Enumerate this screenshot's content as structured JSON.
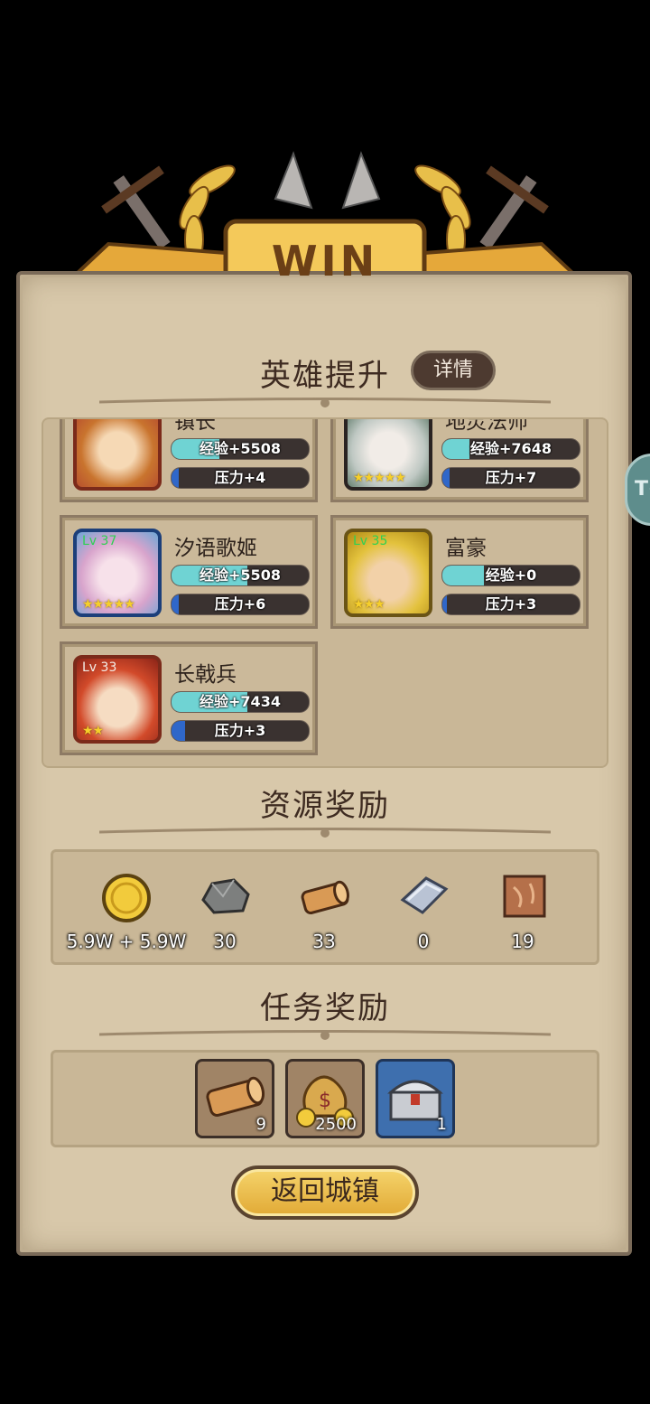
{
  "banner": {
    "title": "WIN"
  },
  "side_bubble_text": "T(",
  "hero_section": {
    "title": "英雄提升",
    "detail_button": "详情",
    "heroes": [
      {
        "name": "镇长",
        "level": "",
        "exp": "经验+5508",
        "exp_fill": 0.35,
        "pressure": "压力+4",
        "pressure_fill": 0.05,
        "stars": ""
      },
      {
        "name": "地灵法师",
        "level": "",
        "exp": "经验+7648",
        "exp_fill": 0.2,
        "pressure": "压力+7",
        "pressure_fill": 0.05,
        "stars": "★★★★★"
      },
      {
        "name": "汐语歌姬",
        "level": "Lv 37",
        "exp": "经验+5508",
        "exp_fill": 0.55,
        "pressure": "压力+6",
        "pressure_fill": 0.05,
        "stars": "★★★★★"
      },
      {
        "name": "富豪",
        "level": "Lv 35",
        "exp": "经验+0",
        "exp_fill": 0.3,
        "pressure": "压力+3",
        "pressure_fill": 0.03,
        "stars": "★★★"
      },
      {
        "name": "长戟兵",
        "level": "Lv 33",
        "exp": "经验+7434",
        "exp_fill": 0.55,
        "pressure": "压力+3",
        "pressure_fill": 0.1,
        "stars": "★★"
      }
    ]
  },
  "resource_section": {
    "title": "资源奖励",
    "items": [
      {
        "icon": "gold-coin-icon",
        "value": "5.9W + 5.9W"
      },
      {
        "icon": "stone-icon",
        "value": "30"
      },
      {
        "icon": "wood-log-icon",
        "value": "33"
      },
      {
        "icon": "iron-ingot-icon",
        "value": "0"
      },
      {
        "icon": "leather-icon",
        "value": "19"
      }
    ]
  },
  "task_section": {
    "title": "任务奖励",
    "items": [
      {
        "icon": "wood-log-icon",
        "value": "9"
      },
      {
        "icon": "money-bag-icon",
        "value": "2500"
      },
      {
        "icon": "treasure-chest-icon",
        "value": "1"
      }
    ]
  },
  "return_button": "返回城镇",
  "colors": {
    "exp_bar": "#6fd3d3",
    "pressure_bar": "#2f67c9",
    "gold": "#f0c64a",
    "panel": "#d8c8aa"
  }
}
